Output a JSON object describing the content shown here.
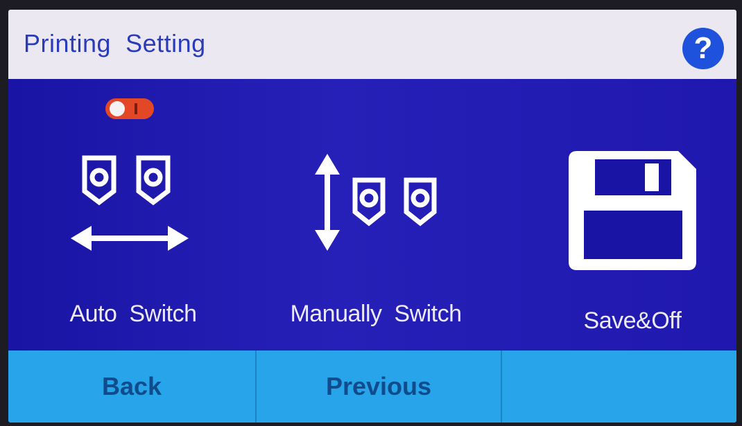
{
  "header": {
    "title": "Printing  Setting",
    "help_icon": "question-mark-icon",
    "help_label": "?"
  },
  "options": [
    {
      "label": "Auto  Switch",
      "icon": "auto-switch-icon",
      "toggle": {
        "state": "on",
        "color": "#e24826"
      }
    },
    {
      "label": "Manually  Switch",
      "icon": "manual-switch-icon"
    },
    {
      "label": "Save&Off",
      "icon": "floppy-disk-icon"
    }
  ],
  "footer": {
    "back_label": "Back",
    "previous_label": "Previous",
    "third_label": ""
  },
  "colors": {
    "title_bar": "#ebe8f2",
    "title_text": "#2a3cb8",
    "content_bg": "#1a14a4",
    "footer_bg": "#27a4ea",
    "footer_text": "#104c8c",
    "help_button": "#1f52dc"
  }
}
